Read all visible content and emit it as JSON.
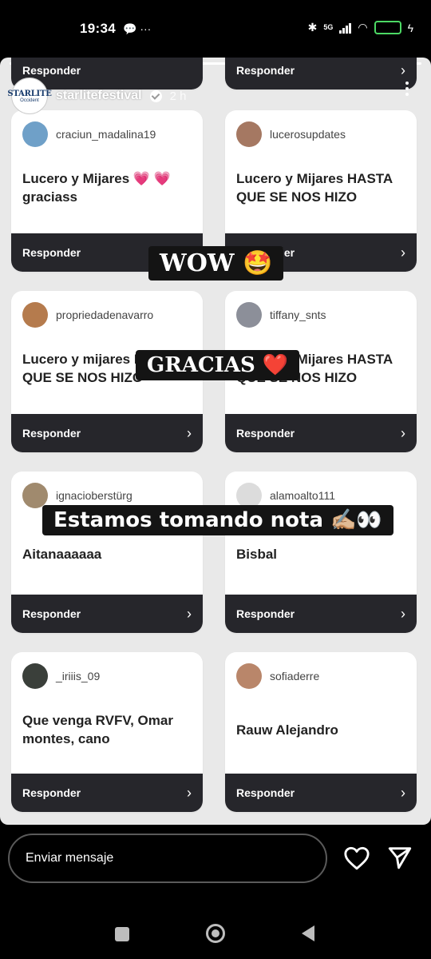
{
  "status_bar": {
    "time": "19:34",
    "left_icons": "💬 ···",
    "network": "5G",
    "battery": "62"
  },
  "story": {
    "username": "starlitefestival",
    "time_ago": "2 h",
    "brand_line1": "STARLITE",
    "brand_line2": "Occident",
    "reply_label": "Responder",
    "cards": [
      {
        "user": "craciun_madalina19",
        "message": "Lucero y Mijares 💗 💗 graciass",
        "avatar_color": "#6fa0c8"
      },
      {
        "user": "lucerosupdates",
        "message": "Lucero y Mijares HASTA QUE SE NOS HIZO",
        "avatar_color": "#a57862"
      },
      {
        "user": "propriedadenavarro",
        "message": "Lucero y mijares HASTA QUE SE NOS HIZO",
        "avatar_color": "#b57b4d"
      },
      {
        "user": "tiffany_snts",
        "message": "Lucero y Mijares HASTA QUE SE NOS HIZO",
        "avatar_color": "#8c8f99"
      },
      {
        "user": "ignacioberstürg",
        "message": "Aitanaaaaaa",
        "avatar_color": "#a08a6e"
      },
      {
        "user": "alamoalto111",
        "message": "Bisbal",
        "avatar_color": "#dcdcdc"
      },
      {
        "user": "_iriiis_09",
        "message": "Que venga RVFV, Omar montes, cano",
        "avatar_color": "#3a3f3a"
      },
      {
        "user": "sofiaderre",
        "message": "Rauw Alejandro",
        "avatar_color": "#b9866a"
      }
    ],
    "stickers": {
      "wow": "WOW 🤩",
      "gracias": "GRACIAS ❤️",
      "nota": "Estamos tomando nota ✍🏼👀"
    }
  },
  "bottom": {
    "message_placeholder": "Enviar mensaje"
  }
}
